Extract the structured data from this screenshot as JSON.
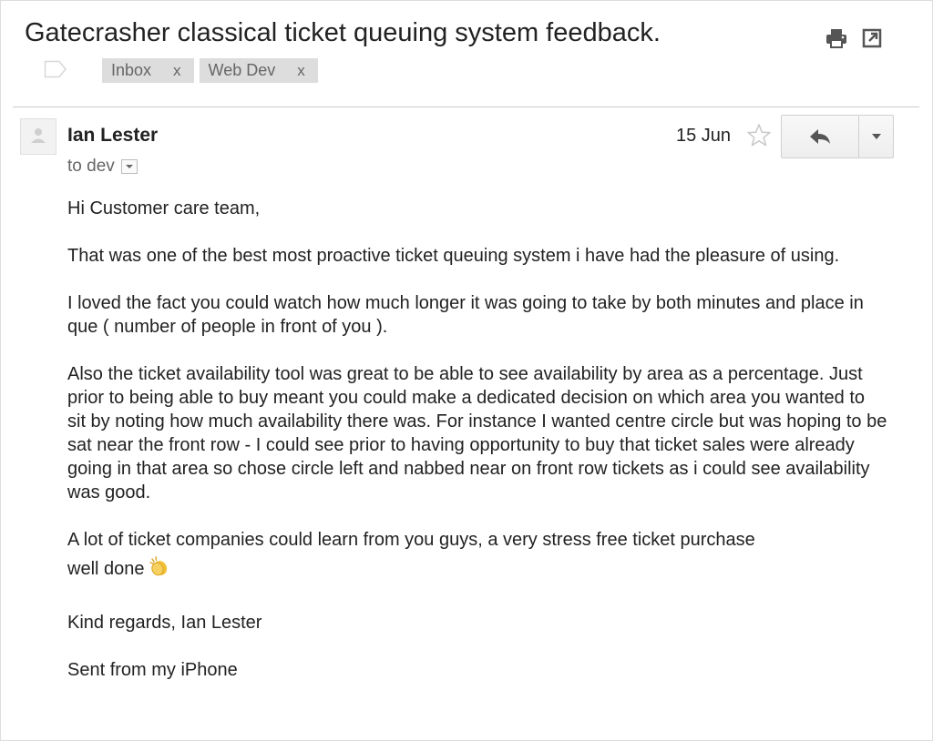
{
  "email": {
    "subject": "Gatecrasher classical ticket queuing system feedback.",
    "labels": [
      {
        "name": "Inbox",
        "remove": "x"
      },
      {
        "name": "Web Dev",
        "remove": "x"
      }
    ],
    "sender": "Ian Lester",
    "recipient": "to dev",
    "date": "15 Jun",
    "body": {
      "greeting": "Hi Customer care team,",
      "p1": "That was one of the best most proactive ticket queuing system i have had the pleasure of using.",
      "p2": "I loved the fact you could watch how much longer it was going to take by both minutes and place in que ( number of people in front of you ).",
      "p3": "Also the ticket availability tool was great to be able to see availability by area as a percentage. Just prior to being able to buy meant you could make a dedicated decision on which area you wanted to sit by noting how much availability there was. For instance I wanted centre circle but was hoping to be sat near the front row - I could see prior to having opportunity to buy that ticket sales were already going in that area so chose circle left and nabbed near on front row tickets as i could see availability was good.",
      "p4": "A lot of ticket companies could learn from you guys, a very stress free ticket purchase",
      "p5": "well done",
      "p6": "Kind regards, Ian Lester",
      "signature": "Sent from my iPhone"
    }
  },
  "icons": {
    "print": "print-icon",
    "new_window": "new-window-icon",
    "label": "label-icon",
    "avatar": "person-icon",
    "expand": "chevron-down-icon",
    "star": "star-icon",
    "reply": "reply-icon",
    "more": "dropdown-arrow-icon",
    "emoji": "clapping-hands-emoji"
  },
  "colors": {
    "tag_bg": "#dddddd",
    "tag_text": "#666666",
    "text": "#222222",
    "muted": "#666666",
    "emoji": "#f2c13a"
  }
}
